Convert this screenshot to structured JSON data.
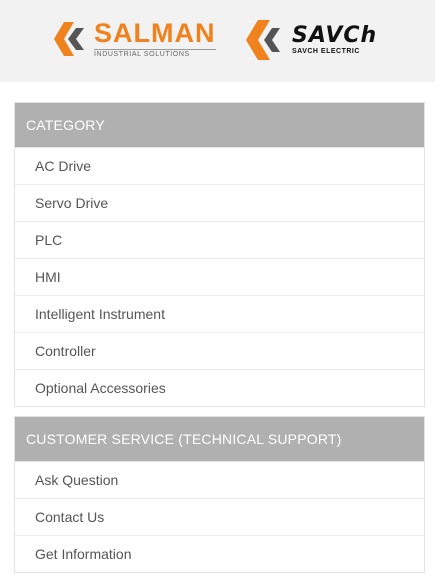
{
  "brands": {
    "salman": {
      "name": "SALMAN",
      "sub": "INDUSTRIAL SOLUTIONS",
      "accent": "#f0821e",
      "icon": "double-chevron-logo"
    },
    "savch": {
      "name": "SAVCh",
      "sub": "SAVCH ELECTRIC",
      "accent": "#f0821e",
      "icon": "double-chevron-logo"
    }
  },
  "category": {
    "title": "CATEGORY",
    "items": [
      {
        "label": "AC Drive"
      },
      {
        "label": "Servo Drive"
      },
      {
        "label": "PLC"
      },
      {
        "label": "HMI"
      },
      {
        "label": "Intelligent Instrument"
      },
      {
        "label": "Controller"
      },
      {
        "label": "Optional Accessories"
      }
    ]
  },
  "customer_service": {
    "title": "CUSTOMER SERVICE (TECHNICAL SUPPORT)",
    "items": [
      {
        "label": "Ask Question"
      },
      {
        "label": "Contact Us"
      },
      {
        "label": "Get Information"
      }
    ]
  },
  "colors": {
    "panel_header": "#b0b0b0",
    "header_bg": "#f2f2f2"
  }
}
